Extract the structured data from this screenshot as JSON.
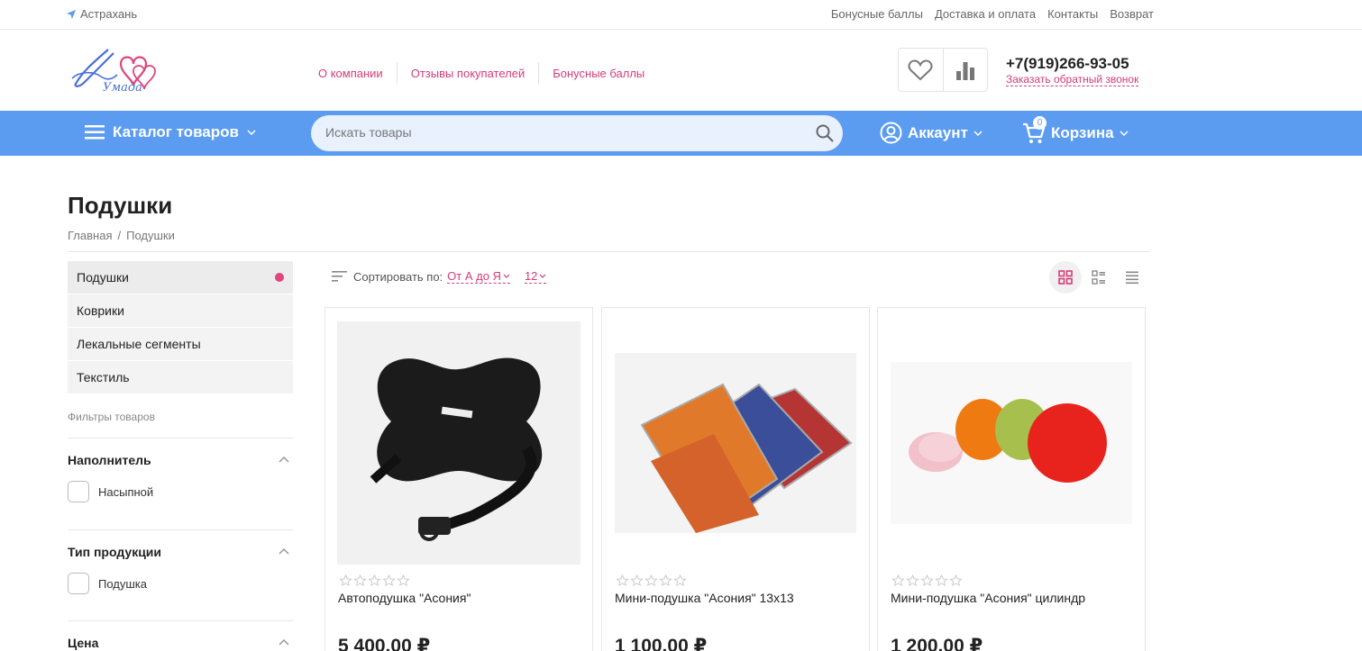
{
  "topbar": {
    "city": "Астрахань",
    "links": [
      "Бонусные баллы",
      "Доставка и оплата",
      "Контакты",
      "Возврат"
    ]
  },
  "header": {
    "logo_text": "Умада",
    "links": [
      "О компании",
      "Отзывы покупателей",
      "Бонусные баллы"
    ],
    "phone": "+7(919)266-93-05",
    "callback": "Заказать обратный звонок"
  },
  "nav": {
    "catalog_label": "Каталог товаров",
    "search_placeholder": "Искать товары",
    "account_label": "Аккаунт",
    "cart_label": "Корзина",
    "cart_count": "0"
  },
  "page": {
    "title": "Подушки",
    "breadcrumbs": [
      "Главная",
      "/",
      "Подушки"
    ]
  },
  "sidebar": {
    "categories": [
      {
        "label": "Подушки",
        "active": true
      },
      {
        "label": "Коврики",
        "active": false
      },
      {
        "label": "Лекальные сегменты",
        "active": false
      },
      {
        "label": "Текстиль",
        "active": false
      }
    ],
    "filters_title": "Фильтры товаров",
    "filters": [
      {
        "title": "Наполнитель",
        "option": "Насыпной"
      },
      {
        "title": "Тип продукции",
        "option": "Подушка"
      },
      {
        "title": "Цена",
        "option": ""
      }
    ]
  },
  "sort": {
    "label": "Сортировать по:",
    "value": "От А до Я",
    "per_page": "12"
  },
  "products": [
    {
      "name": "Автоподушка \"Асония\"",
      "price": "5 400.00 ₽",
      "image": "black-car-pillow"
    },
    {
      "name": "Мини-подушка \"Асония\" 13х13",
      "price": "1 100.00 ₽",
      "image": "colored-square-pillows"
    },
    {
      "name": "Мини-подушка \"Асония\" цилиндр",
      "price": "1 200.00 ₽",
      "image": "colored-round-pillows"
    }
  ],
  "colors": {
    "accent": "#d63b7a",
    "nav": "#5b9cf0",
    "dot": "#e0457b"
  }
}
